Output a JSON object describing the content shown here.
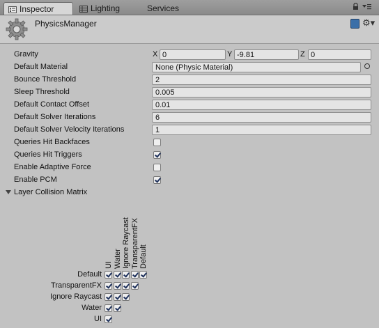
{
  "tabs": [
    {
      "label": "Inspector",
      "icon": "info-icon"
    },
    {
      "label": "Lighting",
      "icon": "lighting-icon"
    },
    {
      "label": "Services",
      "icon": ""
    }
  ],
  "header": {
    "title": "PhysicsManager",
    "icon": "gear-component-icon"
  },
  "properties": {
    "gravity": {
      "label": "Gravity",
      "x_label": "X",
      "x": "0",
      "y_label": "Y",
      "y": "-9.81",
      "z_label": "Z",
      "z": "0"
    },
    "default_material": {
      "label": "Default Material",
      "value": "None (Physic Material)"
    },
    "bounce_threshold": {
      "label": "Bounce Threshold",
      "value": "2"
    },
    "sleep_threshold": {
      "label": "Sleep Threshold",
      "value": "0.005"
    },
    "contact_offset": {
      "label": "Default Contact Offset",
      "value": "0.01"
    },
    "solver_iterations": {
      "label": "Default Solver Iterations",
      "value": "6"
    },
    "solver_velocity_iterations": {
      "label": "Default Solver Velocity Iterations",
      "value": "1"
    },
    "hit_backfaces": {
      "label": "Queries Hit Backfaces",
      "checked": false
    },
    "hit_triggers": {
      "label": "Queries Hit Triggers",
      "checked": true
    },
    "adaptive_force": {
      "label": "Enable Adaptive Force",
      "checked": false
    },
    "enable_pcm": {
      "label": "Enable PCM",
      "checked": true
    }
  },
  "matrix": {
    "label": "Layer Collision Matrix",
    "layers": [
      "Default",
      "TransparentFX",
      "Ignore Raycast",
      "Water",
      "UI"
    ],
    "column_layers": [
      "UI",
      "Water",
      "Ignore Raycast",
      "TransparentFX",
      "Default"
    ]
  }
}
